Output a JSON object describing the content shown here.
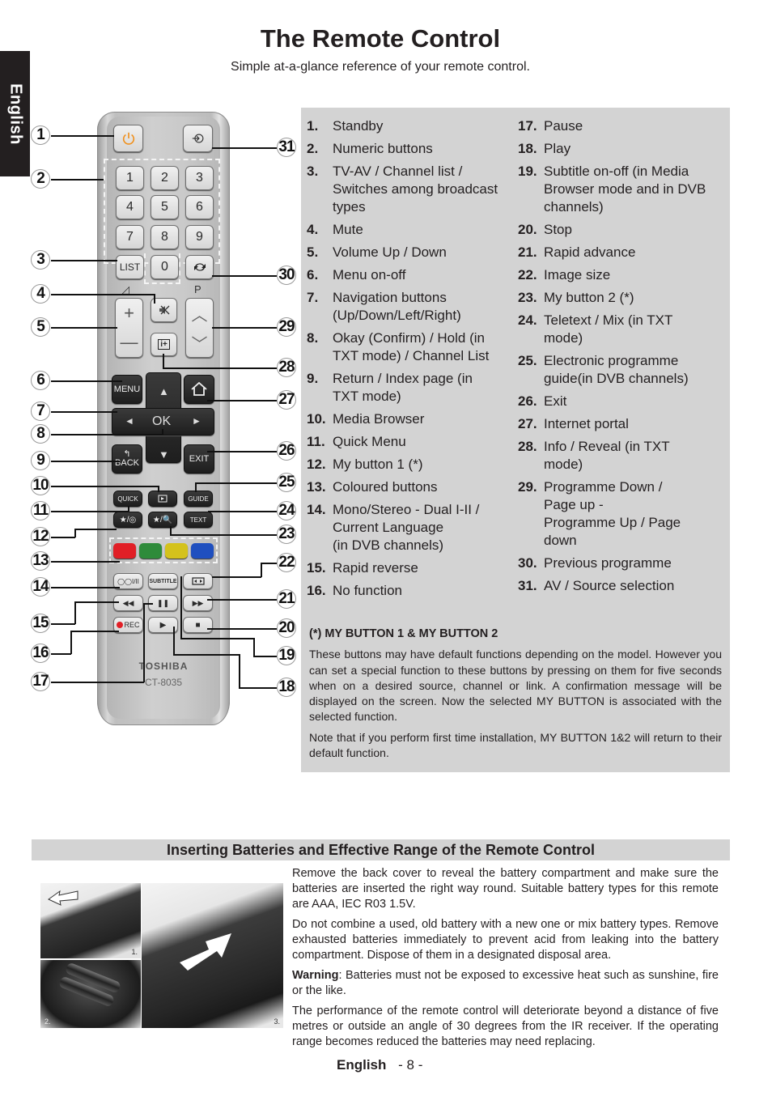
{
  "language_tab": "English",
  "header": {
    "title": "The Remote Control",
    "subtitle": "Simple at-a-glance reference of your remote control."
  },
  "remote": {
    "brand": "TOSHIBA",
    "model": "CT-8035",
    "buttons": {
      "standby_icon": "power-icon",
      "source_icon": "input-icon",
      "numerics": [
        "1",
        "2",
        "3",
        "4",
        "5",
        "6",
        "7",
        "8",
        "9"
      ],
      "list": "LIST",
      "zero": "0",
      "prev_prog_icon": "swap-arrows-icon",
      "vol_up": "+",
      "vol_down": "—",
      "vol_label": "◿",
      "mute_icon": "mute-icon",
      "info": "i+",
      "p_label": "P",
      "p_up": "︿",
      "p_down": "﹀",
      "menu": "MENU",
      "home_icon": "home-icon",
      "up": "▲",
      "down": "▼",
      "left": "◄",
      "right": "►",
      "ok": "OK",
      "back": "BACK",
      "back_arrow": "↰",
      "exit": "EXIT",
      "quick": "QUICK",
      "media_icon": "media-browser-icon",
      "guide": "GUIDE",
      "mybutton1": "★/◎",
      "mybutton2": "★/🔍",
      "text": "TEXT",
      "colors": [
        "#e11f26",
        "#2e8b3a",
        "#d4c21c",
        "#1f4fbf"
      ],
      "lang": "◯◯I/II",
      "subtitle": "SUBTITLE",
      "image_size_icon": "aspect-icon",
      "rew": "◀◀",
      "pause": "❚❚",
      "ffw": "▶▶",
      "rec": "REC",
      "play": "▶",
      "stop": "■"
    }
  },
  "callouts_left": [
    "1",
    "2",
    "3",
    "4",
    "5",
    "6",
    "7",
    "8",
    "9",
    "10",
    "11",
    "12",
    "13",
    "14",
    "15",
    "16",
    "17"
  ],
  "callouts_right": [
    "31",
    "30",
    "29",
    "28",
    "27",
    "26",
    "25",
    "24",
    "23",
    "22",
    "21",
    "20",
    "19",
    "18"
  ],
  "reference": {
    "left": [
      {
        "num": "1.",
        "text": "Standby"
      },
      {
        "num": "2.",
        "text": "Numeric buttons"
      },
      {
        "num": "3.",
        "text": "TV-AV / Channel list /\nSwitches among broadcast\ntypes"
      },
      {
        "num": "4.",
        "text": "Mute"
      },
      {
        "num": "5.",
        "text": "Volume Up / Down"
      },
      {
        "num": "6.",
        "text": "Menu on-off"
      },
      {
        "num": "7.",
        "text": "Navigation buttons\n(Up/Down/Left/Right)"
      },
      {
        "num": "8.",
        "text": "Okay (Confirm) / Hold (in\nTXT mode) / Channel List"
      },
      {
        "num": "9.",
        "text": "Return / Index page (in\nTXT mode)"
      },
      {
        "num": "10.",
        "text": "Media Browser"
      },
      {
        "num": "11.",
        "text": "Quick Menu"
      },
      {
        "num": "12.",
        "text": "My button 1 (*)"
      },
      {
        "num": "13.",
        "text": "Coloured buttons"
      },
      {
        "num": "14.",
        "text": "Mono/Stereo - Dual I-II /\nCurrent  Language\n (in DVB channels)"
      },
      {
        "num": "15.",
        "text": "Rapid reverse"
      },
      {
        "num": "16.",
        "text": "No function"
      }
    ],
    "right": [
      {
        "num": "17.",
        "text": "Pause"
      },
      {
        "num": "18.",
        "text": "Play"
      },
      {
        "num": "19.",
        "text": "Subtitle on-off (in Media\nBrowser mode and in DVB\nchannels)"
      },
      {
        "num": "20.",
        "text": "Stop"
      },
      {
        "num": "21.",
        "text": "Rapid advance"
      },
      {
        "num": "22.",
        "text": "Image size"
      },
      {
        "num": "23.",
        "text": "My button 2 (*)"
      },
      {
        "num": "24.",
        "text": "Teletext / Mix (in TXT\nmode)"
      },
      {
        "num": "25.",
        "text": "Electronic programme\nguide(in DVB channels)"
      },
      {
        "num": "26.",
        "text": "Exit"
      },
      {
        "num": "27.",
        "text": "Internet portal"
      },
      {
        "num": "28.",
        "text": "Info / Reveal (in TXT\nmode)"
      },
      {
        "num": "29.",
        "text": "Programme Down /\nPage up -\nProgramme Up / Page\ndown"
      },
      {
        "num": "30.",
        "text": "Previous programme"
      },
      {
        "num": "31.",
        "text": "AV / Source selection"
      }
    ],
    "note": {
      "heading": "(*) MY BUTTON 1 & MY BUTTON 2",
      "paragraphs": [
        "These buttons may have default functions depending on the  model. However you can set a special function to these buttons by pressing on them for five seconds when on a desired source, channel or link. A confirmation message will be displayed on the screen. Now the selected MY BUTTON is associated with the selected function.",
        "Note that if you perform first time installation, MY BUTTON 1&2 will return to their default function."
      ]
    }
  },
  "batteries": {
    "heading": "Inserting Batteries and Effective Range of the Remote Control",
    "photo_labels": [
      "1.",
      "2.",
      "3."
    ],
    "paragraphs": [
      "Remove the back cover to reveal the battery compartment and make sure the batteries are inserted the right way round. Suitable battery types for this remote are  AAA, IEC R03 1.5V.",
      "Do not combine a used, old battery with a new one or mix battery types. Remove exhausted batteries immediately to prevent acid from leaking into the battery compartment. Dispose of them in a designated disposal area."
    ],
    "warning_label": "Warning",
    "warning_text": ": Batteries must not be exposed to excessive heat such as sunshine, fire or the like.",
    "range_text": "The performance of the remote control will deteriorate beyond a distance of five metres or outside an angle of 30 degrees from the IR receiver. If the operating range becomes reduced the batteries may need replacing."
  },
  "footer": {
    "language": "English",
    "page": "- 8 -"
  }
}
